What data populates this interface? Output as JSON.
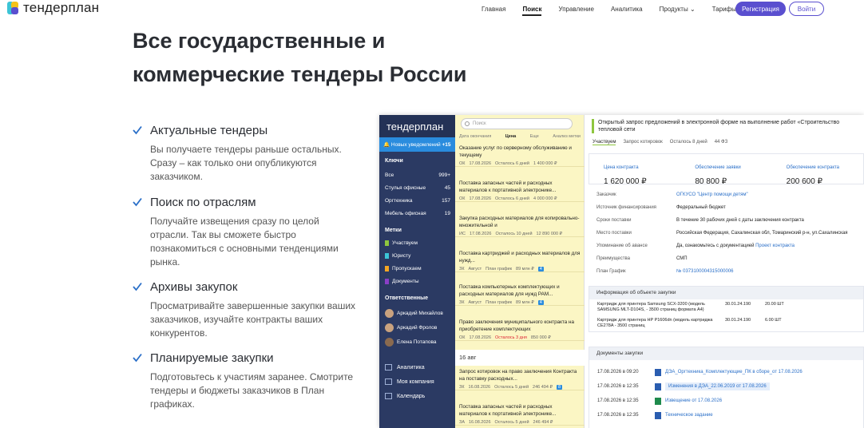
{
  "header": {
    "logo": "тендерплан",
    "nav": [
      {
        "label": "Главная",
        "active": false
      },
      {
        "label": "Поиск",
        "active": true
      },
      {
        "label": "Управление",
        "active": false
      },
      {
        "label": "Аналитика",
        "active": false
      },
      {
        "label": "Продукты",
        "active": false
      },
      {
        "label": "Тарифы",
        "active": false
      }
    ],
    "register_label": "Регистрация",
    "login_label": "Войти",
    "accent": "#5a4fcf"
  },
  "hero": {
    "title": "Все государственные и коммерческие тендеры России"
  },
  "features": [
    {
      "title": "Актуальные тендеры",
      "text": "Вы получаете тендеры раньше остальных. Сразу – как только они опубликуются заказчиком."
    },
    {
      "title": "Поиск по отраслям",
      "text": "Получайте извещения сразу по целой отрасли. Так вы сможете быстро познакомиться с основными тенденциями рынка."
    },
    {
      "title": "Архивы закупок",
      "text": "Просматривайте завершенные закупки ваших заказчиков, изучайте контракты ваших конкурентов."
    },
    {
      "title": "Планируемые закупки",
      "text": "Подготовьтесь к участиям заранее. Смотрите тендеры и бюджеты заказчиков в План графиках."
    }
  ],
  "app": {
    "brand": "тендерплан",
    "notifications": "Новых уведомлений",
    "notifications_count": "+15",
    "keys_title": "Ключи",
    "keys": [
      {
        "label": "Все",
        "count": "999+"
      },
      {
        "label": "Стулья офисные",
        "count": "45"
      },
      {
        "label": "Оргтехника",
        "count": "157"
      },
      {
        "label": "Мебель офисная",
        "count": "19"
      }
    ],
    "tags_title": "Метки",
    "tags": [
      {
        "label": "Участвуем",
        "color": "#8ec63f"
      },
      {
        "label": "Юристу",
        "color": "#3cc4d6"
      },
      {
        "label": "Пропускаем",
        "color": "#f4a623"
      },
      {
        "label": "Документы",
        "color": "#8a3fc6"
      }
    ],
    "resp_title": "Ответственные",
    "people": [
      "Аркадий Михайлов",
      "Аркадий Фролов",
      "Елена Потапова"
    ],
    "menu": [
      "Аналитика",
      "Моя компания",
      "Календарь"
    ],
    "search_placeholder": "Поиск",
    "list_cols": [
      "Дата окончания",
      "Цена",
      "Еще",
      "Анализ метки"
    ],
    "items": [
      {
        "title": "Оказание услуг по серверному обслуживанию и текущему",
        "law": "ОК",
        "date": "17.08.2026",
        "left": "Осталось 6 дней",
        "price": "1 400 000 ₽"
      },
      {
        "title": "Поставка запасных частей и расходных материалов к портативной электронике...",
        "law": "ОК",
        "date": "17.08.2026",
        "left": "Осталось 6 дней",
        "price": "4 000 000 ₽"
      },
      {
        "title": "Закупка расходных материалов для копировально-множительной и",
        "law": "ИС",
        "date": "17.08.2026",
        "left": "Осталось 10 дней",
        "price": "12 890 000 ₽"
      },
      {
        "title": "Поставка картриджей и расходных материалов для нужд...",
        "law": "ЗК",
        "date": "Август",
        "left": "План график",
        "price": "89 млн ₽",
        "badge": "4"
      },
      {
        "title": "Поставка компьютерных комплектующих и расходных материалов для нужд РАМ...",
        "law": "ЗК",
        "date": "Август",
        "left": "План график",
        "price": "89 млн ₽",
        "badge": "4"
      },
      {
        "title": "Право заключения муниципального контракта на приобретение комплектующих",
        "law": "ОК",
        "date": "17.08.2026",
        "left": "Осталось 3 дня",
        "price": "850 000 ₽"
      },
      {
        "title": "Запрос котировок на право заключения Контракта на поставку расходных...",
        "law": "ЗК",
        "date": "16.08.2026",
        "left": "Осталось 5 дней",
        "price": "246 494 ₽",
        "badge": "8"
      },
      {
        "title": "Поставка запасных частей и расходных материалов к портативной электронике...",
        "law": "ЗА",
        "date": "16.08.2026",
        "left": "Осталось 5 дней",
        "price": "246 494 ₽"
      }
    ],
    "day_header": "16 авг",
    "detail": {
      "title": "Открытый запрос предложений в электронной форме на выполнение работ «Строительство тепловой сети",
      "tabs": [
        "Участвуем",
        "Запрос котировок",
        "Осталось 8 дней",
        "44 ФЗ"
      ],
      "prices": [
        {
          "label": "Цена контракта",
          "value": "1 620 000 ₽"
        },
        {
          "label": "Обеспечение заявки",
          "value": "80 800 ₽"
        },
        {
          "label": "Обеспечение контракта",
          "value": "200 600 ₽"
        }
      ],
      "info": [
        {
          "k": "Заказчик",
          "v": "ОГКУСО \"Центр помощи детям\"",
          "link": true
        },
        {
          "k": "Источник финансирования",
          "v": "Федеральный бюджет",
          "link": false
        },
        {
          "k": "Сроки поставки",
          "v": "В течение 30 рабочих дней с даты заключения контракта",
          "link": false
        },
        {
          "k": "Место поставки",
          "v": "Российская Федерация, Сахалинская обл, Томаринский р-н, ул.Сахалинская",
          "link": false
        },
        {
          "k": "Упоминание об авансе",
          "v": "Да, ознакомьтесь с документацией",
          "v2": "Проект контракта",
          "link": false
        },
        {
          "k": "Преимущества",
          "v": "СМП",
          "link": false
        },
        {
          "k": "План График",
          "v": "№ 0373100004315000006",
          "link": true
        }
      ],
      "object_title": "Информация об объекте закупки",
      "goods": [
        {
          "name": "Картридж для принтера Samsung SCX-3200 (модель SAMSUNG MLT-D104S, - 3500 страниц формата А4)",
          "code": "30.01.24.190",
          "qty": "20.00 ШТ"
        },
        {
          "name": "Картридж для принтера HP P1606dn (модель картриджа CE278A - 3500 страниц",
          "code": "30.01.24.190",
          "qty": "6.00 ШТ"
        }
      ],
      "docs_title": "Документы закупки",
      "docs": [
        {
          "date": "17.08.2026 в 09:20",
          "name": "ДЭА_Оргтехника_Комплектующие_ПК в сборе_от 17.08.2026",
          "icon": "word-icon",
          "selected": false
        },
        {
          "date": "17.08.2026 в 12:35",
          "name": "Изменения в ДЭА_22.06.2019 от 17.08.2026",
          "icon": "word-icon",
          "selected": true
        },
        {
          "date": "17.08.2026 в 12:35",
          "name": "Извещение от 17.08.2026",
          "icon": "excel-icon",
          "selected": false
        },
        {
          "date": "17.08.2026 в 12:35",
          "name": "Техническое задание",
          "icon": "word-icon",
          "selected": false
        }
      ]
    }
  }
}
